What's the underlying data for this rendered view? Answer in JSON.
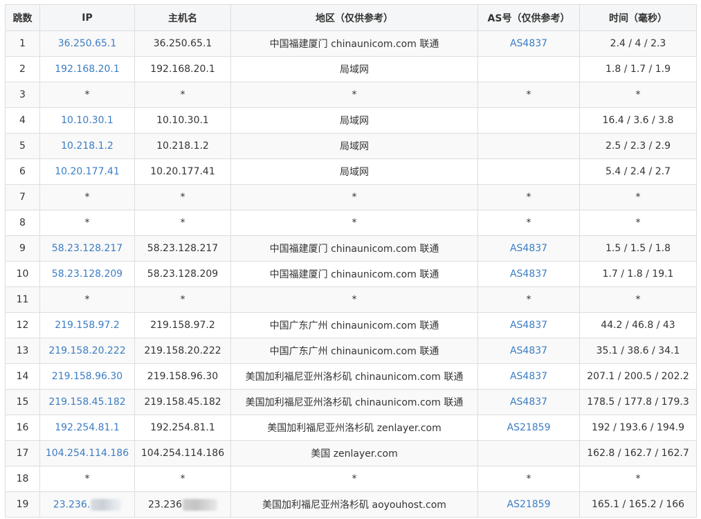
{
  "headers": {
    "hop": "跳数",
    "ip": "IP",
    "host": "主机名",
    "region": "地区（仅供参考）",
    "as": "AS号（仅供参考）",
    "time": "时间（毫秒）"
  },
  "colors": {
    "link": "#3a7cc4",
    "border": "#dddddd",
    "header_bg": "#f5f6f7",
    "stripe_bg": "#f9f9f9"
  },
  "rows": [
    {
      "hop": "1",
      "ip": "36.250.65.1",
      "host": "36.250.65.1",
      "region": "中国福建厦门 chinaunicom.com 联通",
      "as": "AS4837",
      "time": "2.4 / 4 / 2.3"
    },
    {
      "hop": "2",
      "ip": "192.168.20.1",
      "host": "192.168.20.1",
      "region": "局域网",
      "as": "",
      "time": "1.8 / 1.7 / 1.9"
    },
    {
      "hop": "3",
      "ip": "*",
      "host": "*",
      "region": "*",
      "as": "*",
      "time": "*"
    },
    {
      "hop": "4",
      "ip": "10.10.30.1",
      "host": "10.10.30.1",
      "region": "局域网",
      "as": "",
      "time": "16.4 / 3.6 / 3.8"
    },
    {
      "hop": "5",
      "ip": "10.218.1.2",
      "host": "10.218.1.2",
      "region": "局域网",
      "as": "",
      "time": "2.5 / 2.3 / 2.9"
    },
    {
      "hop": "6",
      "ip": "10.20.177.41",
      "host": "10.20.177.41",
      "region": "局域网",
      "as": "",
      "time": "5.4 / 2.4 / 2.7"
    },
    {
      "hop": "7",
      "ip": "*",
      "host": "*",
      "region": "*",
      "as": "*",
      "time": "*"
    },
    {
      "hop": "8",
      "ip": "*",
      "host": "*",
      "region": "*",
      "as": "*",
      "time": "*"
    },
    {
      "hop": "9",
      "ip": "58.23.128.217",
      "host": "58.23.128.217",
      "region": "中国福建厦门 chinaunicom.com 联通",
      "as": "AS4837",
      "time": "1.5 / 1.5 / 1.8"
    },
    {
      "hop": "10",
      "ip": "58.23.128.209",
      "host": "58.23.128.209",
      "region": "中国福建厦门 chinaunicom.com 联通",
      "as": "AS4837",
      "time": "1.7 / 1.8 / 19.1"
    },
    {
      "hop": "11",
      "ip": "*",
      "host": "*",
      "region": "*",
      "as": "*",
      "time": "*"
    },
    {
      "hop": "12",
      "ip": "219.158.97.2",
      "host": "219.158.97.2",
      "region": "中国广东广州 chinaunicom.com 联通",
      "as": "AS4837",
      "time": "44.2 / 46.8 / 43"
    },
    {
      "hop": "13",
      "ip": "219.158.20.222",
      "host": "219.158.20.222",
      "region": "中国广东广州 chinaunicom.com 联通",
      "as": "AS4837",
      "time": "35.1 / 38.6 / 34.1"
    },
    {
      "hop": "14",
      "ip": "219.158.96.30",
      "host": "219.158.96.30",
      "region": "美国加利福尼亚州洛杉矶 chinaunicom.com 联通",
      "as": "AS4837",
      "time": "207.1 / 200.5 / 202.2"
    },
    {
      "hop": "15",
      "ip": "219.158.45.182",
      "host": "219.158.45.182",
      "region": "美国加利福尼亚州洛杉矶 chinaunicom.com 联通",
      "as": "AS4837",
      "time": "178.5 / 177.8 / 179.3"
    },
    {
      "hop": "16",
      "ip": "192.254.81.1",
      "host": "192.254.81.1",
      "region": "美国加利福尼亚州洛杉矶 zenlayer.com",
      "as": "AS21859",
      "time": "192 / 193.6 / 194.9"
    },
    {
      "hop": "17",
      "ip": "104.254.114.186",
      "host": "104.254.114.186",
      "region": "美国 zenlayer.com",
      "as": "",
      "time": "162.8 / 162.7 / 162.7"
    },
    {
      "hop": "18",
      "ip": "*",
      "host": "*",
      "region": "*",
      "as": "*",
      "time": "*"
    },
    {
      "hop": "19",
      "ip": "23.236.",
      "host": "23.236",
      "region": "美国加利福尼亚州洛杉矶 aoyouhost.com",
      "as": "AS21859",
      "time": "165.1 / 165.2 / 166",
      "redacted": true
    }
  ]
}
